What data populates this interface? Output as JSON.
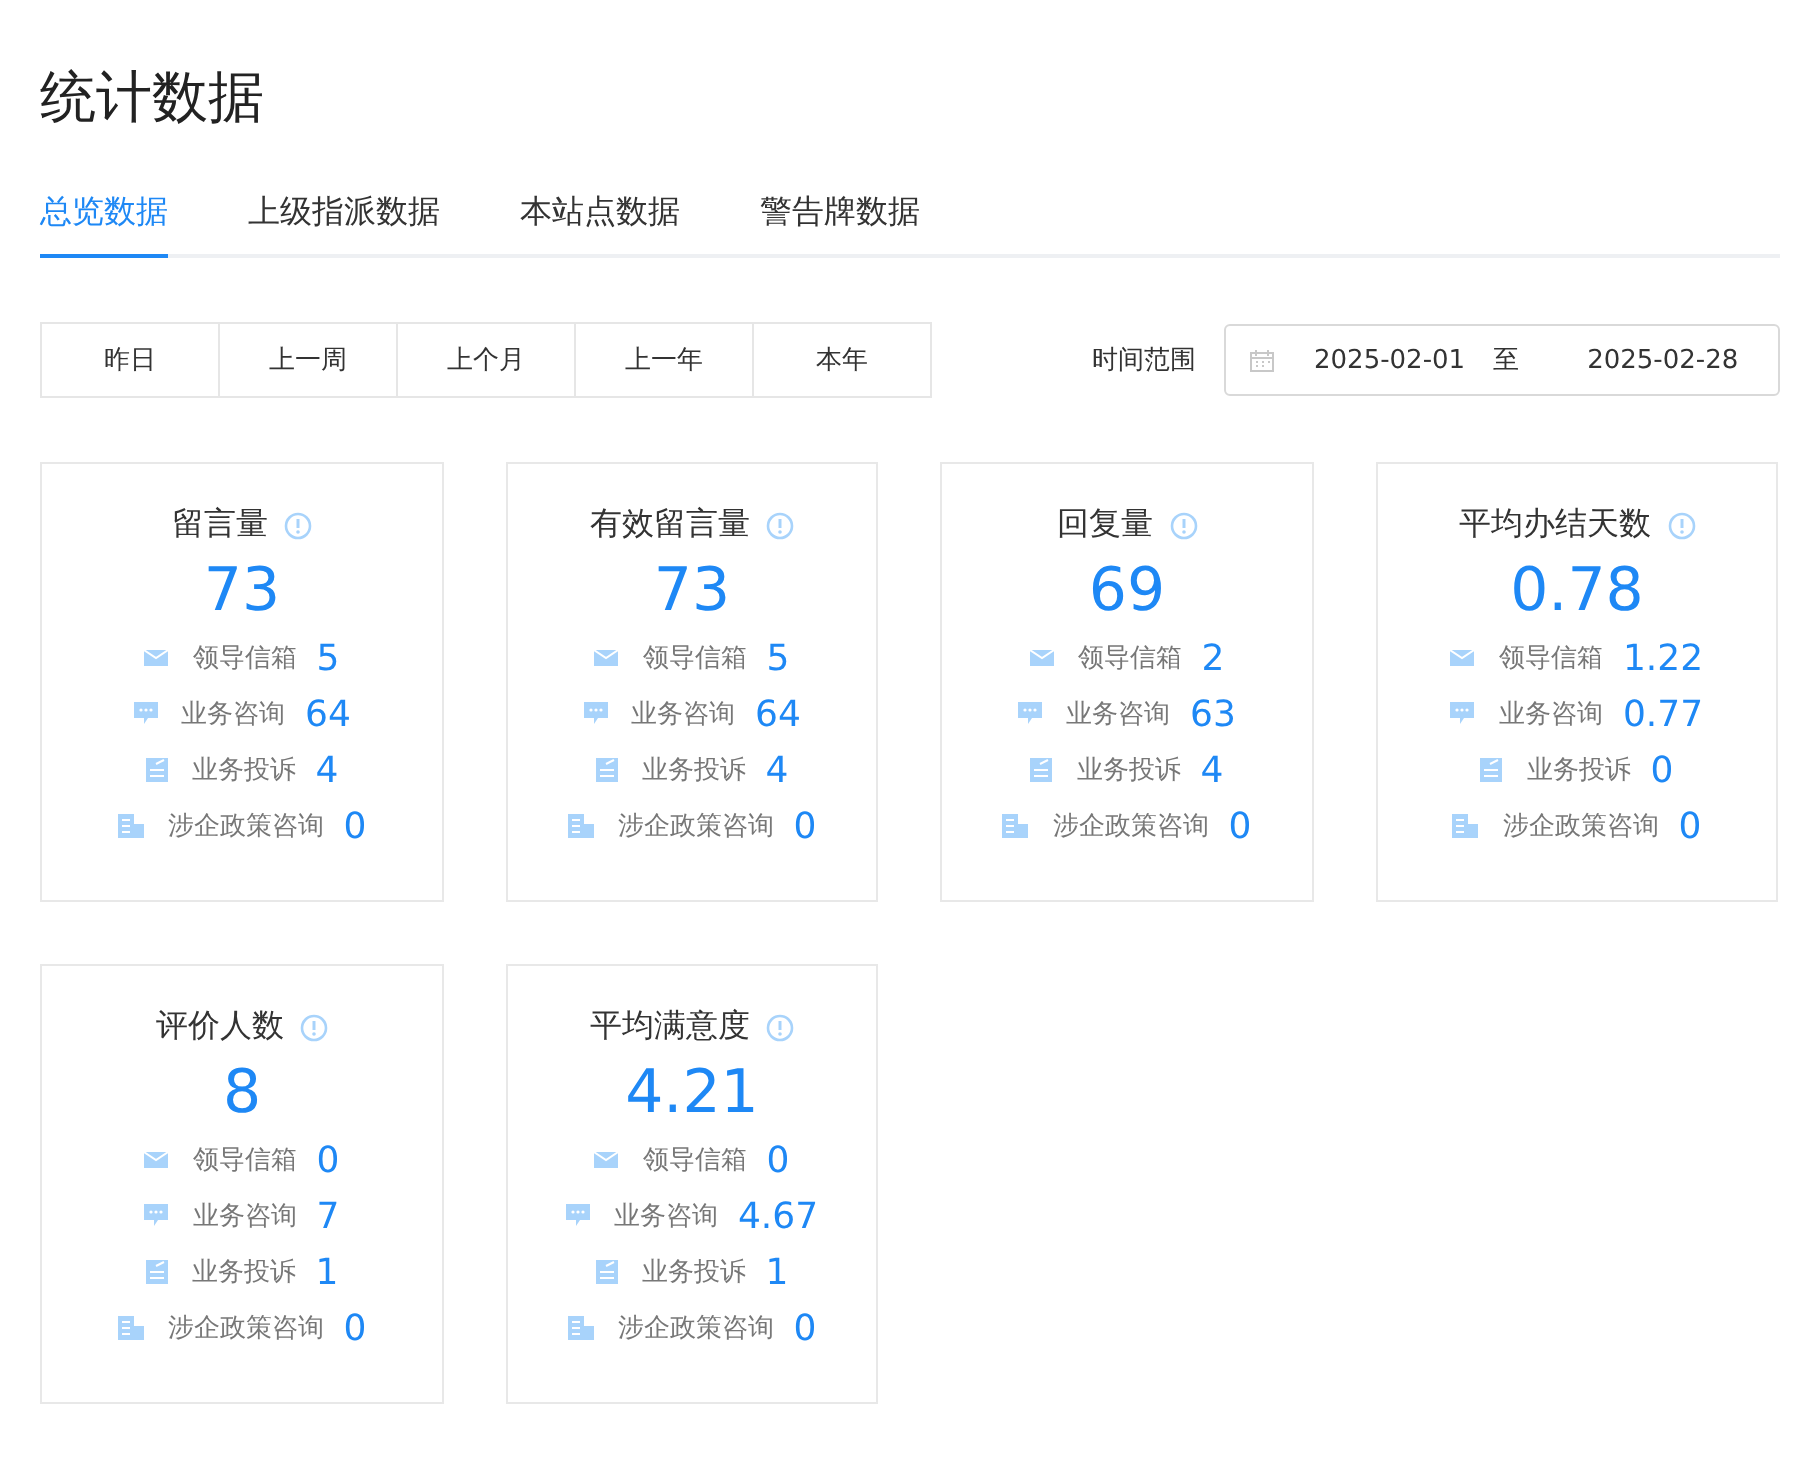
{
  "page_title": "统计数据",
  "tabs": [
    {
      "label": "总览数据",
      "selected": true
    },
    {
      "label": "上级指派数据",
      "selected": false
    },
    {
      "label": "本站点数据",
      "selected": false
    },
    {
      "label": "警告牌数据",
      "selected": false
    }
  ],
  "periods": [
    "昨日",
    "上一周",
    "上个月",
    "上一年",
    "本年"
  ],
  "time_range": {
    "label": "时间范围",
    "start": "2025-02-01",
    "separator": "至",
    "end": "2025-02-28"
  },
  "cards": [
    {
      "title": "留言量",
      "value": "73",
      "rows": [
        {
          "kind": "mail",
          "label": "领导信箱",
          "value": "5"
        },
        {
          "kind": "chat",
          "label": "业务咨询",
          "value": "64"
        },
        {
          "kind": "complaint",
          "label": "业务投诉",
          "value": "4"
        },
        {
          "kind": "policy",
          "label": "涉企政策咨询",
          "value": "0"
        }
      ]
    },
    {
      "title": "有效留言量",
      "value": "73",
      "rows": [
        {
          "kind": "mail",
          "label": "领导信箱",
          "value": "5"
        },
        {
          "kind": "chat",
          "label": "业务咨询",
          "value": "64"
        },
        {
          "kind": "complaint",
          "label": "业务投诉",
          "value": "4"
        },
        {
          "kind": "policy",
          "label": "涉企政策咨询",
          "value": "0"
        }
      ]
    },
    {
      "title": "回复量",
      "value": "69",
      "rows": [
        {
          "kind": "mail",
          "label": "领导信箱",
          "value": "2"
        },
        {
          "kind": "chat",
          "label": "业务咨询",
          "value": "63"
        },
        {
          "kind": "complaint",
          "label": "业务投诉",
          "value": "4"
        },
        {
          "kind": "policy",
          "label": "涉企政策咨询",
          "value": "0"
        }
      ]
    },
    {
      "title": "平均办结天数",
      "value": "0.78",
      "rows": [
        {
          "kind": "mail",
          "label": "领导信箱",
          "value": "1.22"
        },
        {
          "kind": "chat",
          "label": "业务咨询",
          "value": "0.77"
        },
        {
          "kind": "complaint",
          "label": "业务投诉",
          "value": "0"
        },
        {
          "kind": "policy",
          "label": "涉企政策咨询",
          "value": "0"
        }
      ]
    },
    {
      "title": "评价人数",
      "value": "8",
      "rows": [
        {
          "kind": "mail",
          "label": "领导信箱",
          "value": "0"
        },
        {
          "kind": "chat",
          "label": "业务咨询",
          "value": "7"
        },
        {
          "kind": "complaint",
          "label": "业务投诉",
          "value": "1"
        },
        {
          "kind": "policy",
          "label": "涉企政策咨询",
          "value": "0"
        }
      ]
    },
    {
      "title": "平均满意度",
      "value": "4.21",
      "rows": [
        {
          "kind": "mail",
          "label": "领导信箱",
          "value": "0"
        },
        {
          "kind": "chat",
          "label": "业务咨询",
          "value": "4.67"
        },
        {
          "kind": "complaint",
          "label": "业务投诉",
          "value": "1"
        },
        {
          "kind": "policy",
          "label": "涉企政策咨询",
          "value": "0"
        }
      ]
    }
  ]
}
